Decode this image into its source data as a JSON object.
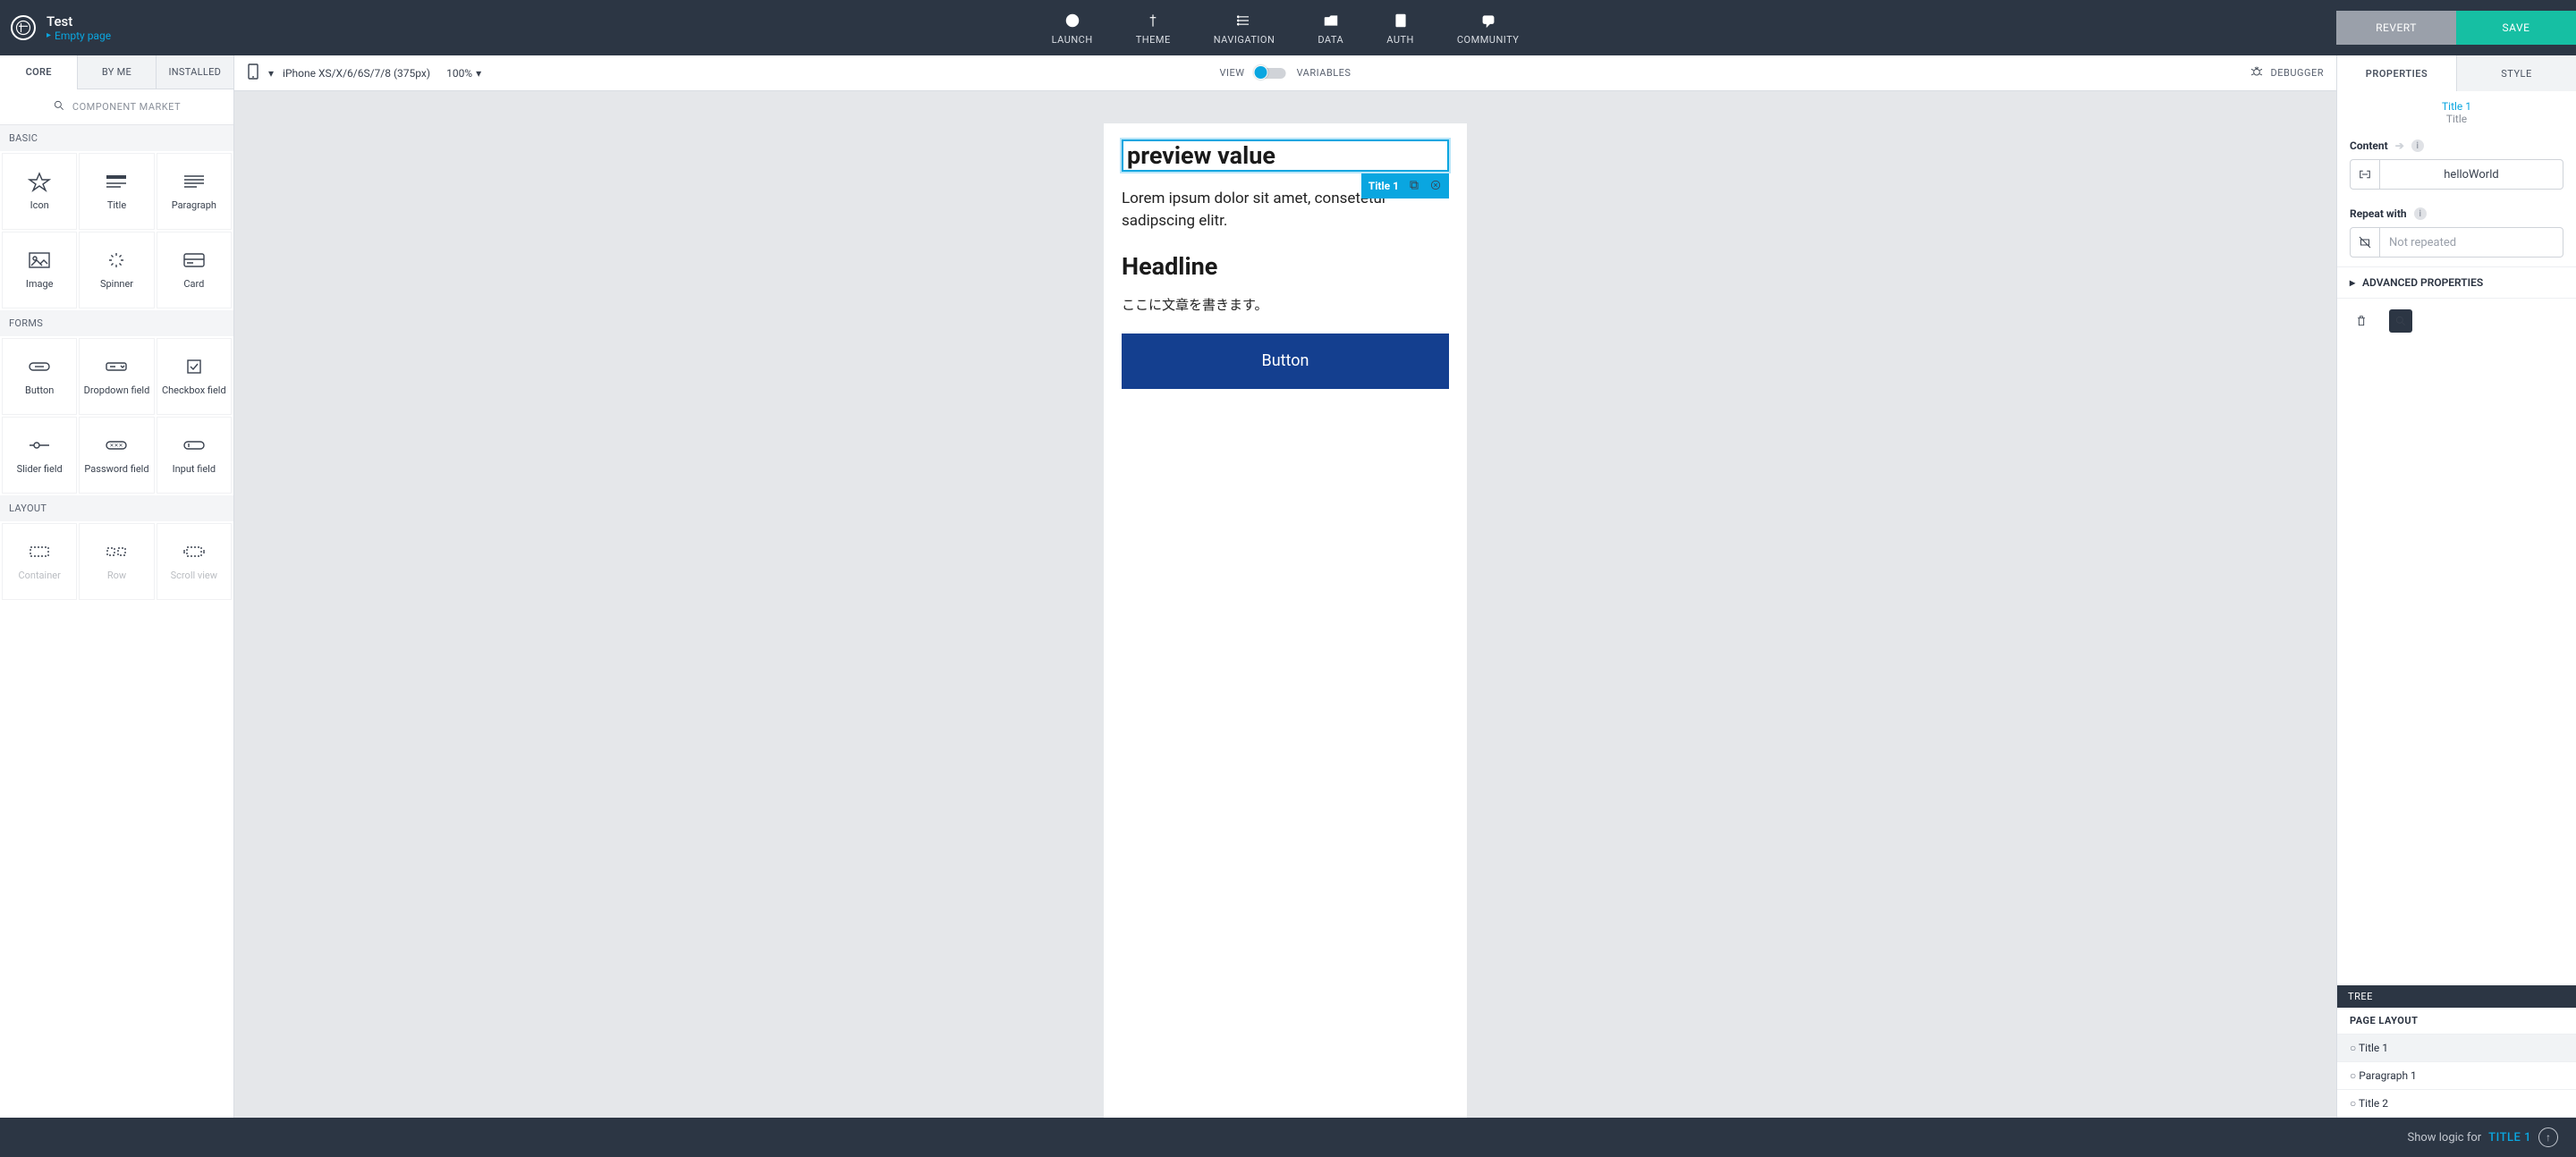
{
  "header": {
    "app_title": "Test",
    "breadcrumb": "Empty page",
    "top_icons": [
      {
        "id": "launch",
        "label": "LAUNCH"
      },
      {
        "id": "theme",
        "label": "THEME"
      },
      {
        "id": "navigation",
        "label": "NAVIGATION"
      },
      {
        "id": "data",
        "label": "DATA"
      },
      {
        "id": "auth",
        "label": "AUTH"
      },
      {
        "id": "community",
        "label": "COMMUNITY"
      }
    ],
    "revert": "REVERT",
    "save": "SAVE"
  },
  "left": {
    "tabs": [
      "CORE",
      "BY ME",
      "INSTALLED"
    ],
    "market": "COMPONENT MARKET",
    "sections": {
      "basic": "BASIC",
      "forms": "FORMS",
      "layout": "LAYOUT"
    },
    "basic_items": [
      "Icon",
      "Title",
      "Paragraph",
      "Image",
      "Spinner",
      "Card"
    ],
    "forms_items": [
      "Button",
      "Dropdown field",
      "Checkbox field",
      "Slider field",
      "Password field",
      "Input field"
    ],
    "layout_items": [
      "Container",
      "Row",
      "Scroll view"
    ]
  },
  "canvas": {
    "device": "iPhone XS/X/6/6S/7/8 (375px)",
    "zoom": "100%",
    "toggle_left": "VIEW",
    "toggle_right": "VARIABLES",
    "debugger": "DEBUGGER",
    "title_value": "preview value",
    "selection_tag": "Title 1",
    "paragraph1": "Lorem ipsum dolor sit amet, consetetur sadipscing elitr.",
    "headline": "Headline",
    "paragraph2": "ここに文章を書きます。",
    "button_label": "Button"
  },
  "right": {
    "tabs": [
      "PROPERTIES",
      "STYLE"
    ],
    "crumb_link": "Title 1",
    "crumb_current": "Title",
    "content_label": "Content",
    "content_value": "helloWorld",
    "repeat_label": "Repeat with",
    "repeat_placeholder": "Not repeated",
    "advanced": "ADVANCED PROPERTIES",
    "tree_head": "TREE",
    "page_layout": "PAGE LAYOUT",
    "tree_items": [
      "Title 1",
      "Paragraph 1",
      "Title 2"
    ]
  },
  "footer": {
    "prefix": "Show logic for",
    "target": "TITLE 1"
  }
}
